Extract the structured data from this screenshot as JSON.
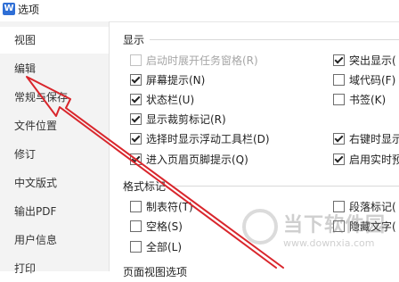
{
  "window": {
    "title": "选项",
    "icon": "wps-writer-icon"
  },
  "sidebar": {
    "items": [
      {
        "label": "视图",
        "active": true
      },
      {
        "label": "编辑",
        "active": false
      },
      {
        "label": "常规与保存",
        "active": false
      },
      {
        "label": "文件位置",
        "active": false
      },
      {
        "label": "修订",
        "active": false
      },
      {
        "label": "中文版式",
        "active": false
      },
      {
        "label": "输出PDF",
        "active": false
      },
      {
        "label": "用户信息",
        "active": false
      },
      {
        "label": "打印",
        "active": false
      }
    ]
  },
  "display": {
    "title": "显示",
    "left": [
      {
        "label": "启动时展开任务窗格(R)",
        "checked": false,
        "disabled": true
      },
      {
        "label": "屏幕提示(N)",
        "checked": true,
        "disabled": false
      },
      {
        "label": "状态栏(U)",
        "checked": true,
        "disabled": false
      },
      {
        "label": "显示裁剪标记(R)",
        "checked": true,
        "disabled": false
      },
      {
        "label": "选择时显示浮动工具栏(D)",
        "checked": true,
        "disabled": false
      },
      {
        "label": "进入页眉页脚提示(Q)",
        "checked": true,
        "disabled": false
      }
    ],
    "right": [
      {
        "label": "突出显示(",
        "checked": true
      },
      {
        "label": "域代码(F)",
        "checked": false
      },
      {
        "label": "书签(K)",
        "checked": false
      },
      {
        "label": "右键时显示",
        "checked": true
      },
      {
        "label": "启用实时预",
        "checked": true
      }
    ]
  },
  "format_marks": {
    "title": "格式标记",
    "left": [
      {
        "label": "制表符(T)",
        "checked": false
      },
      {
        "label": "空格(S)",
        "checked": false
      },
      {
        "label": "全部(L)",
        "checked": false
      }
    ],
    "right": [
      {
        "label": "段落标记(",
        "checked": false
      },
      {
        "label": "隐藏文字(",
        "checked": false
      }
    ]
  },
  "page_view": {
    "title": "页面视图选项"
  },
  "annotation": {
    "color": "#d9262c"
  },
  "watermark": {
    "text": "当下软件园",
    "url": "www.downxia.com"
  }
}
